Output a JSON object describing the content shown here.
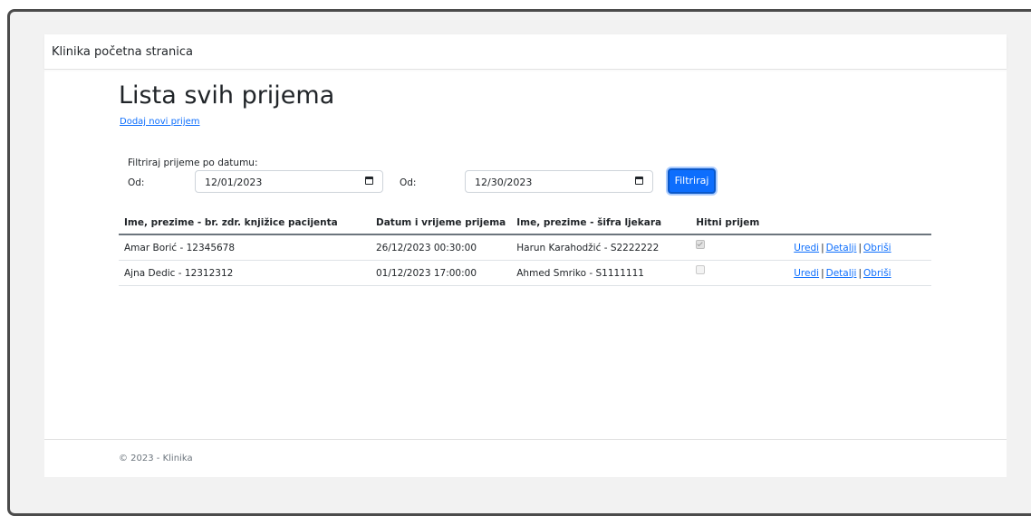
{
  "navbar": {
    "brand": "Klinika početna stranica"
  },
  "page": {
    "title": "Lista svih prijema",
    "add_link": "Dodaj novi prijem"
  },
  "filter": {
    "label": "Filtriraj prijeme po datumu:",
    "from_label_1": "Od:",
    "from_value_1": "12/01/2023",
    "from_label_2": "Od:",
    "from_value_2": "12/30/2023",
    "button": "Filtriraj"
  },
  "table": {
    "headers": [
      "Ime, prezime - br. zdr. knjižice pacijenta",
      "Datum i vrijeme prijema",
      "Ime, prezime - šifra ljekara",
      "Hitni prijem",
      ""
    ],
    "rows": [
      {
        "patient": "Amar Borić - 12345678",
        "datetime": "26/12/2023 00:30:00",
        "doctor": "Harun Karahodžić - S2222222",
        "urgent": true,
        "edit": "Uredi",
        "details": "Detalji",
        "delete": "Obriši",
        "sep": "|"
      },
      {
        "patient": "Ajna Dedic - 12312312",
        "datetime": "01/12/2023 17:00:00",
        "doctor": "Ahmed Smriko - S1111111",
        "urgent": false,
        "edit": "Uredi",
        "details": "Detalji",
        "delete": "Obriši",
        "sep": "|"
      }
    ]
  },
  "footer": {
    "copyright": "© 2023 - Klinika"
  },
  "colors": {
    "primary": "#0d6efd",
    "frame": "#4b4b4b",
    "background": "#f2f2f2"
  }
}
